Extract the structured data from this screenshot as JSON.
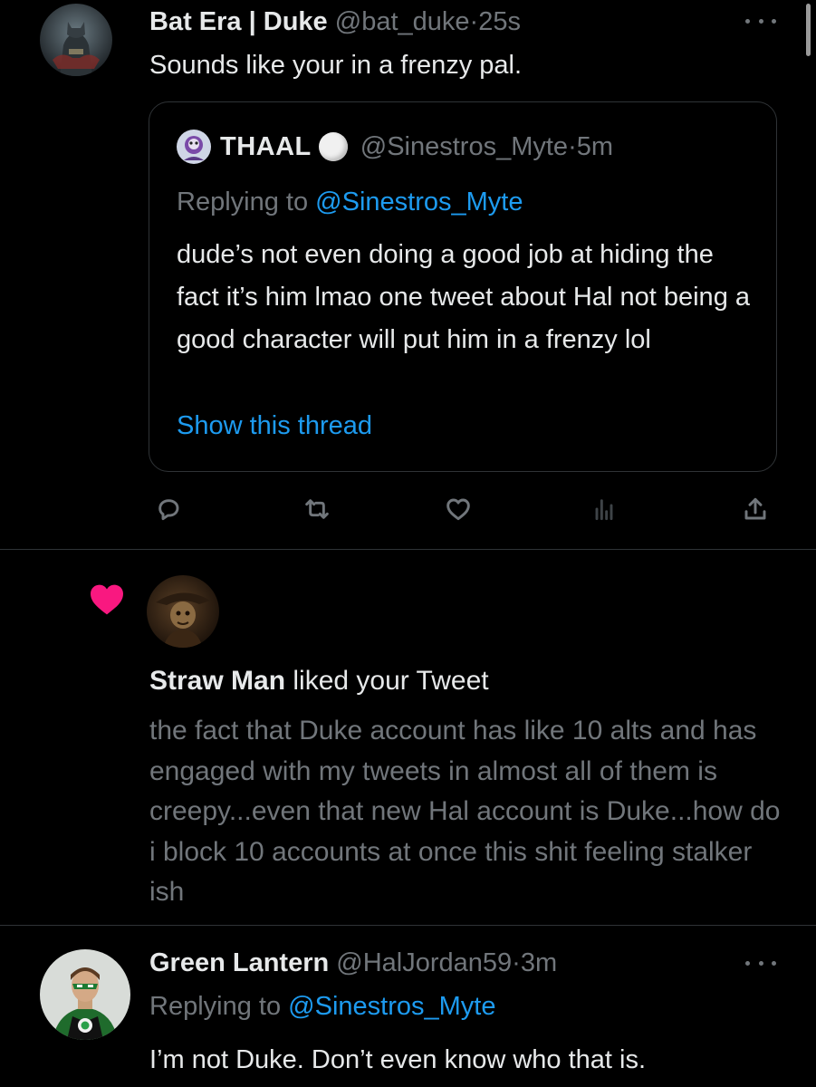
{
  "tweet1": {
    "name": "Bat Era | Duke",
    "handle": "@bat_duke",
    "separator": "·",
    "time": "25s",
    "text": "Sounds like your in a frenzy pal.",
    "quote": {
      "name": "THAAL",
      "handle": "@Sinestros_Myte",
      "separator": "·",
      "time": "5m",
      "replying_prefix": "Replying to ",
      "replying_to": "@Sinestros_Myte",
      "text": "dude’s not even doing a good job at hiding the fact it’s him lmao one tweet about Hal not being a good character will put him in a frenzy lol",
      "show_thread": "Show this thread"
    },
    "actions": [
      "reply-icon",
      "retweet-icon",
      "like-icon",
      "views-icon",
      "share-icon"
    ]
  },
  "notification": {
    "icon": "heart-icon",
    "icon_color": "#f91880",
    "actor": "Straw Man",
    "action_text": " liked your Tweet",
    "tweet_text": "the fact that Duke account has like 10 alts and has engaged with my tweets in almost all of them is creepy...even that new Hal account is Duke...how do i block 10 accounts at once this shit feeling stalker ish"
  },
  "tweet2": {
    "name": "Green Lantern",
    "handle": "@HalJordan59",
    "separator": "·",
    "time": "3m",
    "replying_prefix": "Replying to ",
    "replying_to": "@Sinestros_Myte",
    "text": "I’m not Duke. Don’t even know who that is."
  },
  "colors": {
    "background": "#000000",
    "primary_text": "#e7e9ea",
    "secondary_text": "#71767b",
    "link": "#1d9bf0",
    "border": "#2f3336"
  }
}
